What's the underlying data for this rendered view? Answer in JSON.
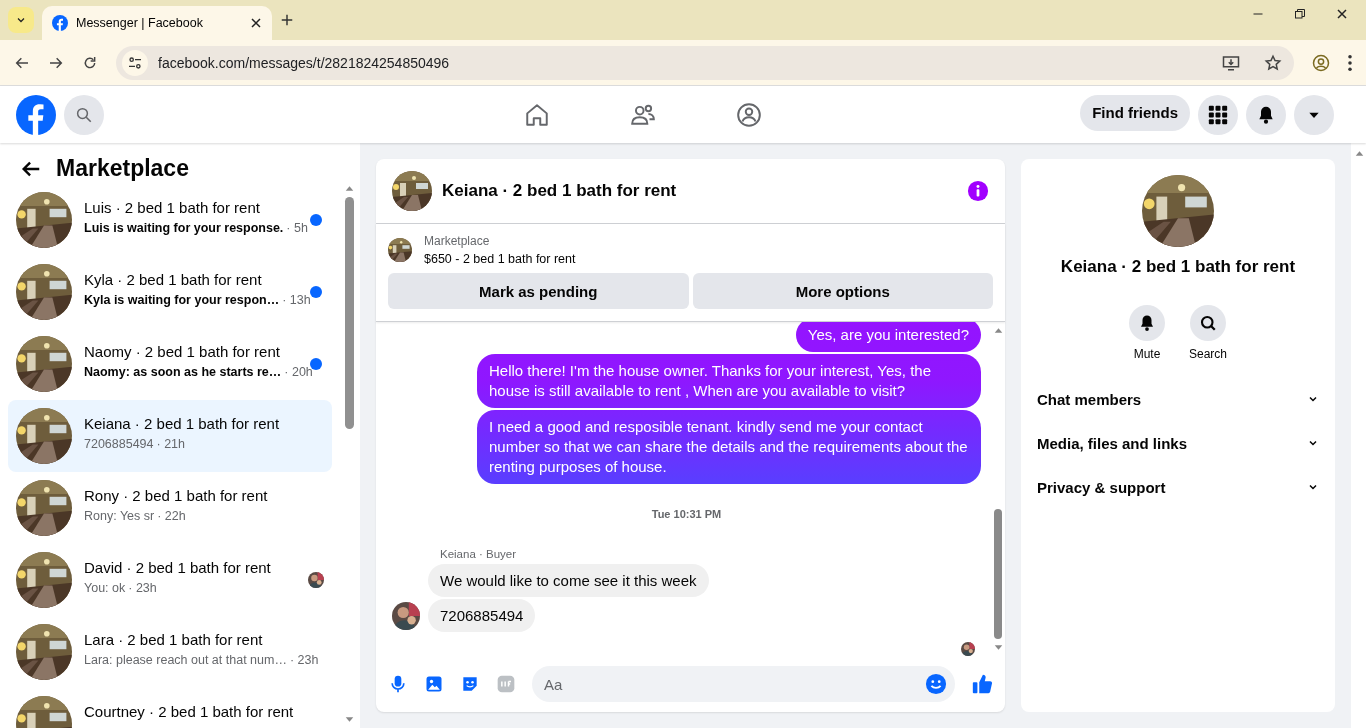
{
  "browser": {
    "tab_title": "Messenger | Facebook",
    "url": "facebook.com/messages/t/2821824254850496"
  },
  "header": {
    "find_friends": "Find friends"
  },
  "sidebar": {
    "title": "Marketplace",
    "conversations": [
      {
        "title": "Luis · 2 bed 1 bath for rent",
        "preview": "Luis is waiting for your response.",
        "time": "· 5h",
        "unread": true,
        "selected": false,
        "seen": false
      },
      {
        "title": "Kyla · 2 bed 1 bath for rent",
        "preview": "Kyla is waiting for your respon…",
        "time": "· 13h",
        "unread": true,
        "selected": false,
        "seen": false
      },
      {
        "title": "Naomy · 2 bed 1 bath for rent",
        "preview": "Naomy: as soon as he starts re…",
        "time": "· 20h",
        "unread": true,
        "selected": false,
        "seen": false
      },
      {
        "title": "Keiana · 2 bed 1 bath for rent",
        "preview": "7206885494",
        "time": "· 21h",
        "unread": false,
        "selected": true,
        "seen": false
      },
      {
        "title": "Rony · 2 bed 1 bath for rent",
        "preview": "Rony: Yes sr",
        "time": "· 22h",
        "unread": false,
        "selected": false,
        "seen": false
      },
      {
        "title": "David · 2 bed 1 bath for rent",
        "preview": "You: ok",
        "time": "· 23h",
        "unread": false,
        "selected": false,
        "seen": true
      },
      {
        "title": "Lara · 2 bed 1 bath for rent",
        "preview": "Lara: please reach out at that num…",
        "time": "· 23h",
        "unread": false,
        "selected": false,
        "seen": false
      },
      {
        "title": "Courtney · 2 bed 1 bath for rent",
        "unread": false,
        "selected": false,
        "seen": false
      }
    ]
  },
  "chat": {
    "title": "Keiana · 2 bed 1 bath for rent",
    "listing": {
      "label": "Marketplace",
      "text": "$650 - 2 bed 1 bath for rent"
    },
    "actions": [
      "Mark as pending",
      "More options"
    ],
    "messages": [
      {
        "kind": "outgoing",
        "text": "Yes, are you interested?"
      },
      {
        "kind": "outgoing",
        "text": "Hello there! I'm the house owner. Thanks for your interest, Yes, the house is still available to rent , When are you available to visit?"
      },
      {
        "kind": "outgoing",
        "text": "I need a good and resposible tenant.  kindly send me your contact number so that we can share the details and the requirements about the renting purposes of house."
      },
      {
        "kind": "timestamp",
        "text": "Tue 10:31 PM"
      },
      {
        "kind": "sender",
        "text": "Keiana · Buyer"
      },
      {
        "kind": "incoming",
        "text": "We would like to come see it this week",
        "avatar": false
      },
      {
        "kind": "incoming",
        "text": "7206885494",
        "avatar": true
      }
    ],
    "seen": true,
    "composer": {
      "placeholder": "Aa"
    }
  },
  "details": {
    "title": "Keiana · 2 bed 1 bath for rent",
    "actions": [
      {
        "kind": "mute",
        "label": "Mute"
      },
      {
        "kind": "search",
        "label": "Search"
      }
    ],
    "sections": [
      "Chat members",
      "Media, files and links",
      "Privacy & support"
    ]
  }
}
